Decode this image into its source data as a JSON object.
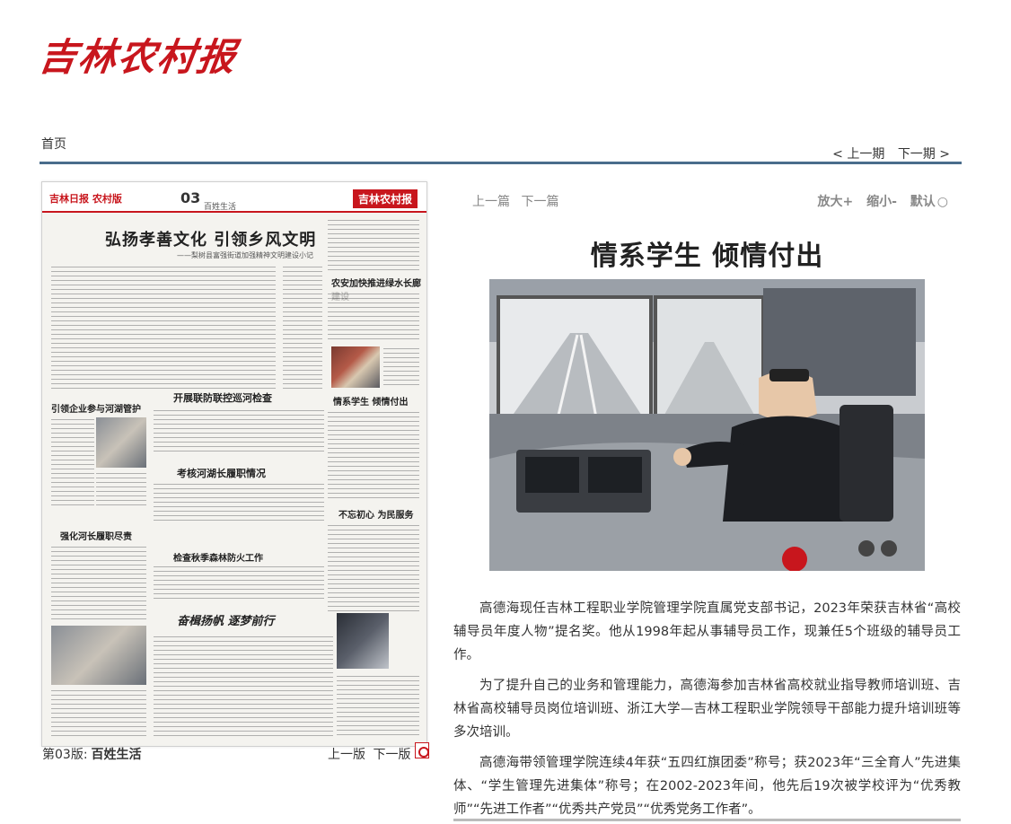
{
  "logo": {
    "text": "吉林农村报"
  },
  "nav": {
    "home": "首页",
    "prev_issue": "< 上一期",
    "next_issue": "下一期 >"
  },
  "paper": {
    "header_left": "吉林日报 农村版",
    "page_number": "03",
    "section": "百姓生活",
    "header_right": "吉林农村报",
    "headline": "弘扬孝善文化 引领乡风文明",
    "subheadline": "——梨树县富强街道加强精神文明建设小记",
    "h_guanzhi": "引领企业参与河湖管护",
    "h_xunhe": "开展联防联控巡河检查",
    "h_nongan": "农安加快推进绿水长廊建设",
    "h_kaohe": "考核河湖长履职情况",
    "h_hezhang": "强化河长履职尽责",
    "h_qingxi": "情系学生 倾情付出",
    "h_senlin": "检查秋季森林防火工作",
    "h_buwang": "不忘初心 为民服务",
    "h_fenji": "奋楫扬帆 逐梦前行"
  },
  "page_bar": {
    "label": "第03版:",
    "section": "百姓生活",
    "prev": "上一版",
    "next": "下一版",
    "pdf_icon": "pdf-icon"
  },
  "article": {
    "prev": "上一篇",
    "next": "下一篇",
    "font_larger": "放大+",
    "font_smaller": "缩小-",
    "font_default": "默认",
    "title": "情系学生 倾情付出",
    "paragraphs": [
      "高德海现任吉林工程职业学院管理学院直属党支部书记，2023年荣获吉林省“高校辅导员年度人物”提名奖。他从1998年起从事辅导员工作，现兼任5个班级的辅导员工作。",
      "为了提升自己的业务和管理能力，高德海参加吉林省高校就业指导教师培训班、吉林省高校辅导员岗位培训班、浙江大学—吉林工程职业学院领导干部能力提升培训班等多次培训。",
      "高德海带领管理学院连续4年获“五四红旗团委”称号；获2023年“三全育人”先进集体、“学生管理先进集体”称号；在2002-2023年间，他先后19次被学校评为“优秀教师”“先进工作者”“优秀共产党员”“优秀党务工作者”。"
    ]
  },
  "colors": {
    "brand_red": "#c8161d",
    "rule_blue": "#4a6d8c"
  }
}
